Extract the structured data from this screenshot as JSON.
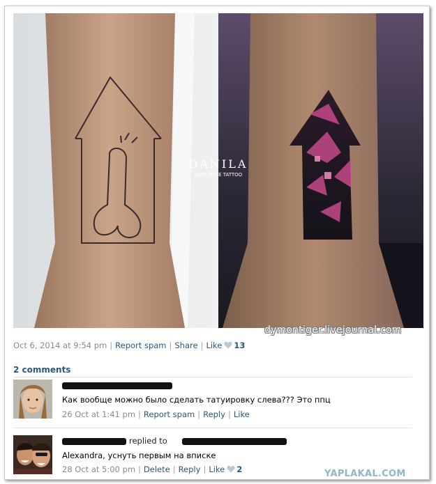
{
  "post": {
    "date": "Oct 6, 2014 at 9:54 pm",
    "report_spam": "Report spam",
    "share": "Share",
    "like": "Like",
    "like_count": "13"
  },
  "photo": {
    "watermark_brand": "DANILA",
    "watermark_sub": "LOVE HATE TATTOO",
    "watermark_site": "dymontiger.livejournal.com"
  },
  "comments": {
    "count_label": "2 comments",
    "items": [
      {
        "text": "Как вообще можно было сделать татуировку слева??? Это ппц",
        "time": "26 Oct at 1:41 pm",
        "report_spam": "Report spam",
        "reply": "Reply",
        "like": "Like"
      },
      {
        "replied_to": "replied to",
        "text": "Alexandra, уснуть первым на вписке",
        "time": "28 Oct at 5:00 pm",
        "delete": "Delete",
        "reply": "Reply",
        "like": "Like",
        "like_count": "2"
      }
    ]
  },
  "footer_watermark": "YAPLAKAL.COM",
  "colors": {
    "link": "#2b587a",
    "meta": "#8a8a8a",
    "heart": "#b9c8d8",
    "watermark": "#8fb6c8"
  }
}
